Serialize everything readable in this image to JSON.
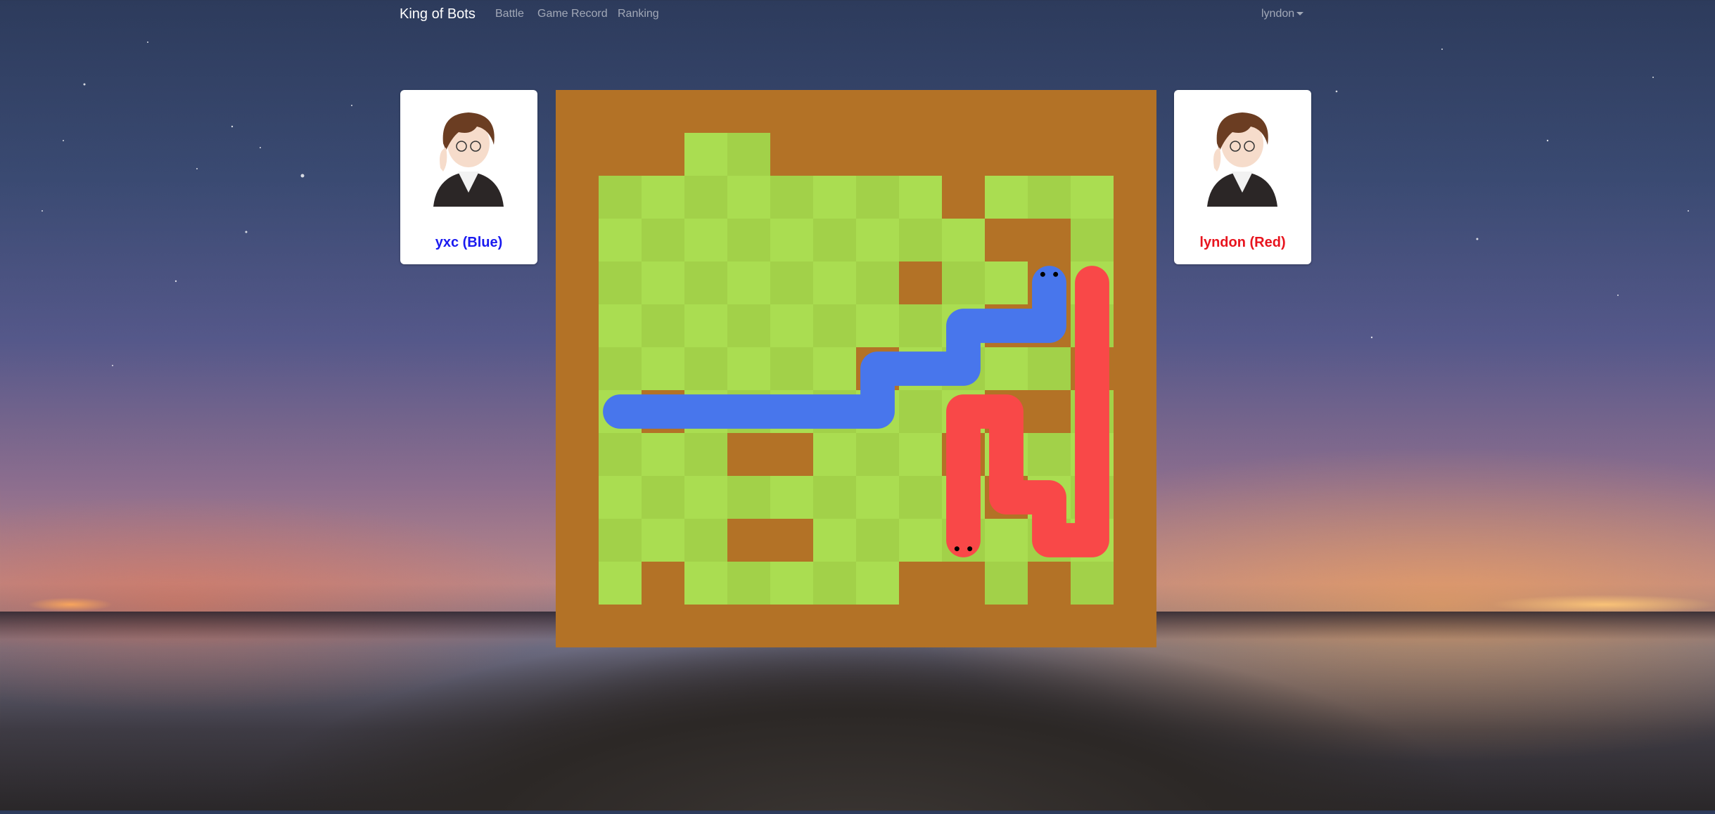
{
  "navbar": {
    "brand": "King of Bots",
    "links": [
      "Battle",
      "Game Record",
      "Ranking"
    ],
    "user": "lyndon"
  },
  "players": {
    "blue": {
      "label": "yxc (Blue)"
    },
    "red": {
      "label": "lyndon (Red)"
    }
  },
  "game": {
    "rows": 13,
    "cols": 14,
    "colors": {
      "wall": "#b37226",
      "grass_light": "#aadd51",
      "grass_dark": "#a2d149",
      "blue_snake": "#4876ec",
      "red_snake": "#f94848"
    },
    "walls": [
      [
        1,
        1
      ],
      [
        1,
        2
      ],
      [
        1,
        5
      ],
      [
        1,
        6
      ],
      [
        1,
        7
      ],
      [
        1,
        8
      ],
      [
        1,
        9
      ],
      [
        1,
        10
      ],
      [
        1,
        11
      ],
      [
        1,
        12
      ],
      [
        2,
        9
      ],
      [
        3,
        11
      ],
      [
        3,
        10
      ],
      [
        4,
        11
      ],
      [
        4,
        8
      ],
      [
        5,
        11
      ],
      [
        5,
        10
      ],
      [
        6,
        7
      ],
      [
        6,
        12
      ],
      [
        7,
        11
      ],
      [
        7,
        10
      ],
      [
        7,
        2
      ],
      [
        8,
        4
      ],
      [
        8,
        5
      ],
      [
        8,
        9
      ],
      [
        9,
        10
      ],
      [
        10,
        4
      ],
      [
        10,
        5
      ],
      [
        11,
        2
      ],
      [
        11,
        9
      ],
      [
        11,
        8
      ],
      [
        11,
        11
      ]
    ],
    "blue_snake": [
      [
        4,
        11
      ],
      [
        5,
        11
      ],
      [
        5,
        10
      ],
      [
        5,
        9
      ],
      [
        6,
        9
      ],
      [
        6,
        8
      ],
      [
        6,
        7
      ],
      [
        7,
        7
      ],
      [
        7,
        6
      ],
      [
        7,
        5
      ],
      [
        7,
        4
      ],
      [
        7,
        3
      ],
      [
        7,
        2
      ],
      [
        7,
        1
      ]
    ],
    "red_snake": [
      [
        10,
        9
      ],
      [
        9,
        9
      ],
      [
        8,
        9
      ],
      [
        7,
        9
      ],
      [
        7,
        10
      ],
      [
        8,
        10
      ],
      [
        9,
        10
      ],
      [
        9,
        11
      ],
      [
        10,
        11
      ],
      [
        10,
        12
      ],
      [
        9,
        12
      ],
      [
        8,
        12
      ],
      [
        7,
        12
      ],
      [
        6,
        12
      ],
      [
        5,
        12
      ],
      [
        4,
        12
      ]
    ]
  }
}
